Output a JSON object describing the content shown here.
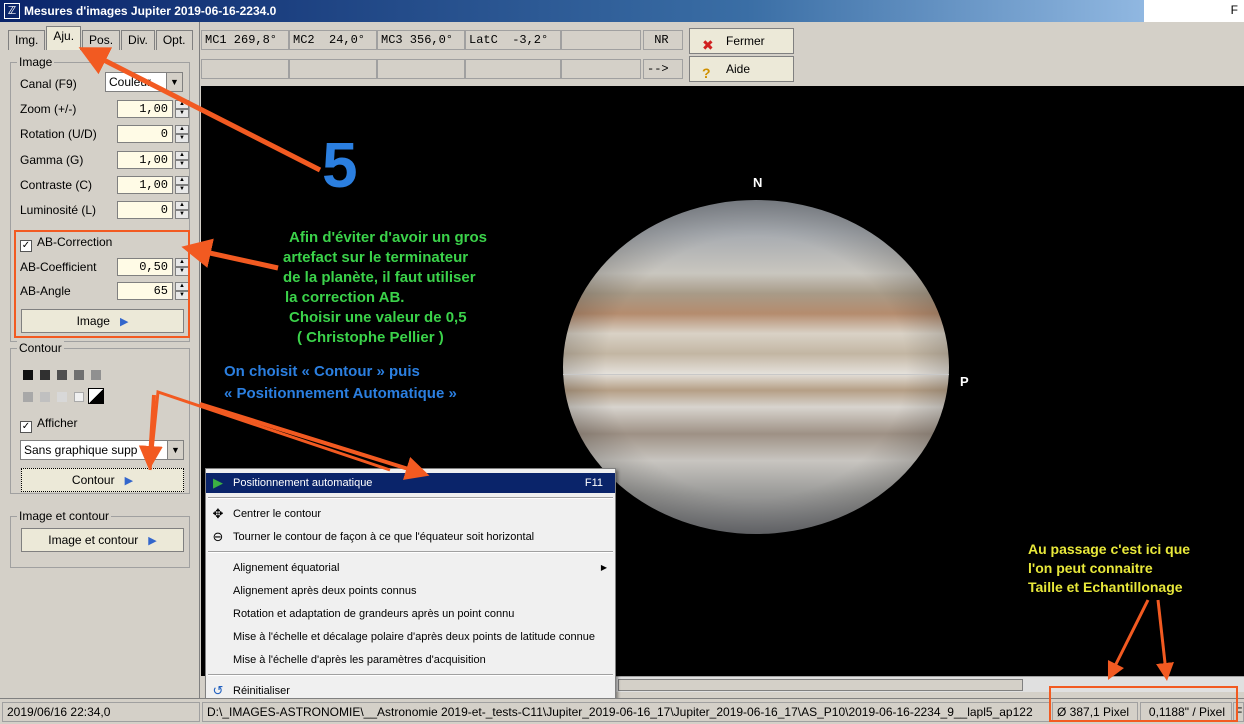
{
  "window": {
    "title": "Mesures d'images Jupiter  2019-06-16-2234.0",
    "right_mark": "F"
  },
  "tabs": [
    {
      "label": "Img."
    },
    {
      "label": "Aju."
    },
    {
      "label": "Pos."
    },
    {
      "label": "Div."
    },
    {
      "label": "Opt."
    }
  ],
  "image_group": {
    "label": "Image",
    "canal_label": "Canal (F9)",
    "canal_value": "Couleur",
    "zoom_label": "Zoom (+/-)",
    "zoom_value": "1,00",
    "rotation_label": "Rotation (U/D)",
    "rotation_value": "0",
    "gamma_label": "Gamma (G)",
    "gamma_value": "1,00",
    "contraste_label": "Contraste (C)",
    "contraste_value": "1,00",
    "luminosite_label": "Luminosité (L)",
    "luminosite_value": "0",
    "ab_correction_label": "AB-Correction",
    "ab_coef_label": "AB-Coefficient",
    "ab_coef_value": "0,50",
    "ab_angle_label": "AB-Angle",
    "ab_angle_value": "65",
    "image_button": "Image"
  },
  "contour_group": {
    "label": "Contour",
    "afficher_label": "Afficher",
    "graphic_value": "Sans graphique supp",
    "contour_button": "Contour"
  },
  "image_contour_group": {
    "label": "Image et contour",
    "button": "Image et contour"
  },
  "top_cells": {
    "mc1": "MC1 269,8°",
    "mc2": "MC2  24,0°",
    "mc3": "MC3 356,0°",
    "latc": "LatC  -3,2°",
    "blank1": "",
    "nr": " NR",
    "arrow": "-->"
  },
  "buttons": {
    "fermer": "Fermer",
    "aide": "Aide"
  },
  "planet_labels": {
    "north": "N",
    "p": "P"
  },
  "context_menu": {
    "items": [
      {
        "label": "Positionnement automatique",
        "shortcut": "F11"
      },
      {
        "label": "Centrer le contour"
      },
      {
        "label": "Tourner le contour de façon à ce que l'équateur soit horizontal"
      },
      {
        "label": "Alignement équatorial"
      },
      {
        "label": "Alignement après deux points connus"
      },
      {
        "label": "Rotation et adaptation de grandeurs après un point connu"
      },
      {
        "label": "Mise à l'échelle et décalage polaire d'après deux points de latitude connue"
      },
      {
        "label": "Mise à l'échelle d'après les paramètres d'acquisition"
      },
      {
        "label": "Réinitialiser"
      }
    ]
  },
  "statusbar": {
    "date": "2019/06/16   22:34,0",
    "path": "D:\\_IMAGES-ASTRONOMIE\\__Astronomie 2019-et-_tests-C11\\Jupiter_2019-06-16_17\\Jupiter_2019-06-16_17\\AS_P10\\2019-06-16-2234_9__lapl5_ap122",
    "size": "Ø 387,1 Pixel",
    "sampling": "0,1188\" / Pixel",
    "edge": "F"
  },
  "annotations": {
    "step": "5",
    "green": [
      "Afin d'éviter d'avoir un gros",
      "artefact sur le terminateur",
      "de la planète, il faut utiliser",
      "la correction AB.",
      "Choisir une valeur de 0,5",
      "( Christophe Pellier )"
    ],
    "blue": [
      "On choisit « Contour » puis",
      "« Positionnement Automatique »"
    ],
    "yellow": [
      "Au passage c'est ici que",
      "l'on peut connaitre",
      "Taille et Echantillonage"
    ]
  },
  "colors": {
    "annotation_red": "#f25a21",
    "menu_highlight": "#0a246a",
    "green_text": "#3bd24a",
    "blue_text": "#2b7fe0",
    "yellow_text": "#e8e83a"
  }
}
